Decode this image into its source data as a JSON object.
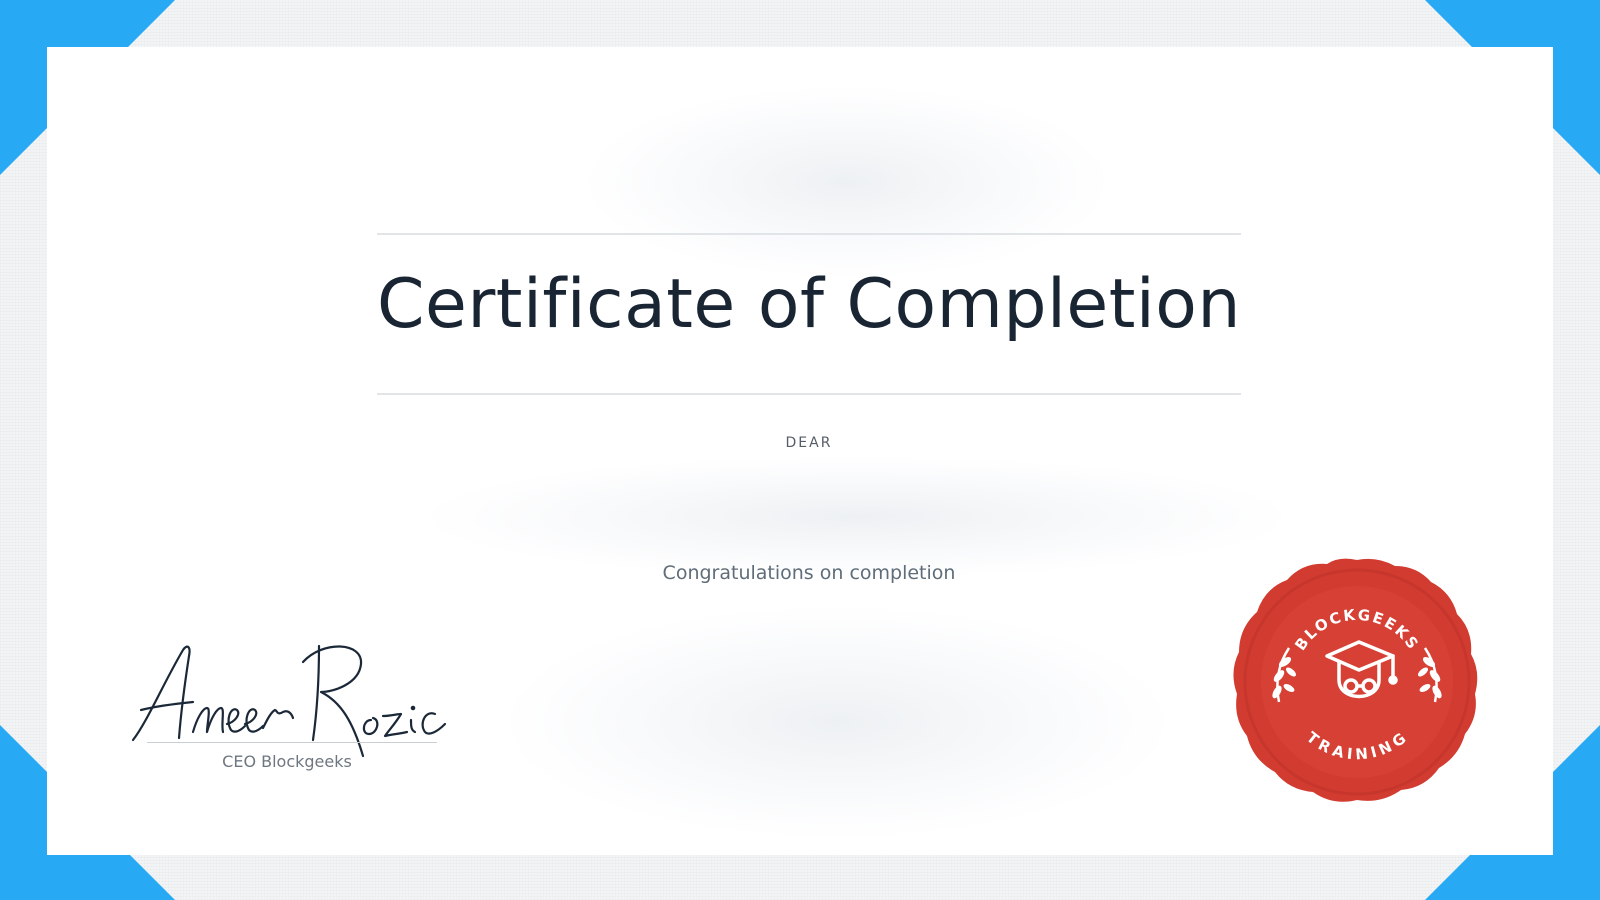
{
  "certificate": {
    "title": "Certificate of Completion",
    "salutation": "DEAR",
    "message": "Congratulations on completion",
    "signature_name": "Ameer Rosic",
    "signature_caption": "CEO Blockgeeks",
    "seal_top_text": "BLOCKGEEKS",
    "seal_bottom_text": "TRAINING"
  },
  "colors": {
    "corner_accent": "#27a9f3",
    "seal_red": "#d23b30",
    "title_text": "#1a2533"
  },
  "icons": {
    "seal_emblem": "graduation-cap-icon",
    "seal_laurels": "laurel-icon"
  }
}
